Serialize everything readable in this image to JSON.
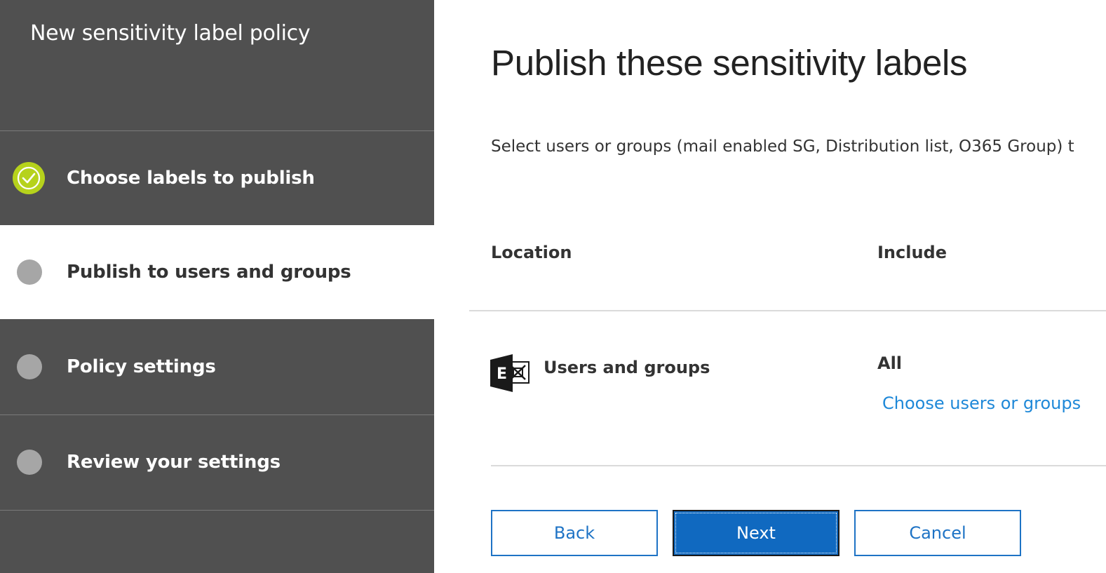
{
  "sidebar": {
    "title": "New sensitivity label policy",
    "steps": [
      {
        "label": "Choose labels to publish",
        "state": "done"
      },
      {
        "label": "Publish to users and groups",
        "state": "current"
      },
      {
        "label": "Policy settings",
        "state": "pending"
      },
      {
        "label": "Review your settings",
        "state": "pending"
      }
    ]
  },
  "main": {
    "title": "Publish these sensitivity labels",
    "description": "Select users or groups (mail enabled SG, Distribution list, O365 Group) t",
    "table": {
      "headers": {
        "location": "Location",
        "include": "Include"
      },
      "rows": [
        {
          "icon": "exchange-icon",
          "location": "Users and groups",
          "include": "All",
          "link": "Choose users or groups"
        }
      ]
    }
  },
  "buttons": {
    "back": "Back",
    "next": "Next",
    "cancel": "Cancel"
  },
  "colors": {
    "sidebar_bg": "#505050",
    "done_step": "#b6d21c",
    "pending_dot": "#a6a6a6",
    "link": "#1e88d8",
    "primary_button": "#1069c0"
  }
}
